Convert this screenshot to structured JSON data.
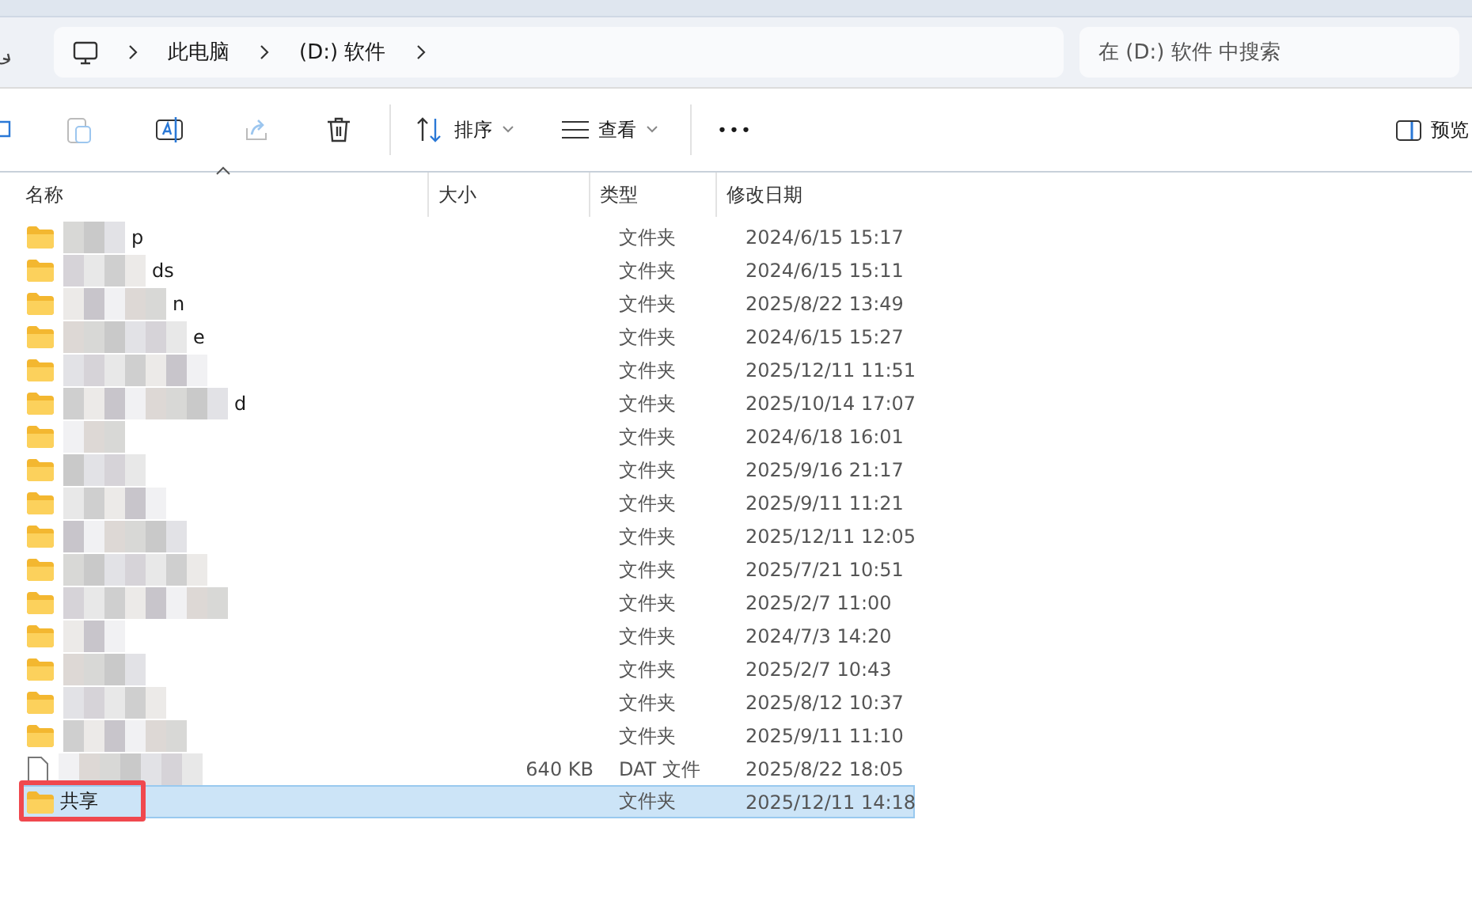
{
  "address_bar": {
    "segments": [
      "此电脑",
      "(D:) 软件"
    ]
  },
  "search": {
    "placeholder": "在 (D:) 软件 中搜索"
  },
  "toolbar": {
    "sort": "排序",
    "view": "查看",
    "more": "•••",
    "preview": "预览"
  },
  "columns": [
    "名称",
    "大小",
    "类型",
    "修改日期"
  ],
  "rows": [
    {
      "kind": "folder",
      "name_tail": "p",
      "redacted": true,
      "type": "文件夹",
      "modified": "2024/6/15 15:17",
      "selected": false
    },
    {
      "kind": "folder",
      "name_tail": "ds",
      "redacted": true,
      "type": "文件夹",
      "modified": "2024/6/15 15:11",
      "selected": false
    },
    {
      "kind": "folder",
      "name_tail": "n",
      "redacted": true,
      "type": "文件夹",
      "modified": "2025/8/22 13:49",
      "selected": false
    },
    {
      "kind": "folder",
      "name_tail": "e",
      "redacted": true,
      "type": "文件夹",
      "modified": "2024/6/15 15:27",
      "selected": false
    },
    {
      "kind": "folder",
      "redacted": true,
      "type": "文件夹",
      "modified": "2025/12/11 11:51",
      "selected": false
    },
    {
      "kind": "folder",
      "name_tail": "d",
      "redacted": true,
      "type": "文件夹",
      "modified": "2025/10/14 17:07",
      "selected": false
    },
    {
      "kind": "folder",
      "redacted": true,
      "type": "文件夹",
      "modified": "2024/6/18 16:01",
      "selected": false
    },
    {
      "kind": "folder",
      "redacted": true,
      "type": "文件夹",
      "modified": "2025/9/16 21:17",
      "selected": false
    },
    {
      "kind": "folder",
      "redacted": true,
      "type": "文件夹",
      "modified": "2025/9/11 11:21",
      "selected": false
    },
    {
      "kind": "folder",
      "redacted": true,
      "type": "文件夹",
      "modified": "2025/12/11 12:05",
      "selected": false
    },
    {
      "kind": "folder",
      "redacted": true,
      "type": "文件夹",
      "modified": "2025/7/21 10:51",
      "selected": false
    },
    {
      "kind": "folder",
      "redacted": true,
      "type": "文件夹",
      "modified": "2025/2/7 11:00",
      "selected": false
    },
    {
      "kind": "folder",
      "redacted": true,
      "type": "文件夹",
      "modified": "2024/7/3 14:20",
      "selected": false
    },
    {
      "kind": "folder",
      "redacted": true,
      "type": "文件夹",
      "modified": "2025/2/7 10:43",
      "selected": false
    },
    {
      "kind": "folder",
      "redacted": true,
      "type": "文件夹",
      "modified": "2025/8/12 10:37",
      "selected": false
    },
    {
      "kind": "folder",
      "redacted": true,
      "type": "文件夹",
      "modified": "2025/9/11 11:10",
      "selected": false
    },
    {
      "kind": "file",
      "redacted": true,
      "size": "640 KB",
      "type": "DAT 文件",
      "modified": "2025/8/22 18:05",
      "selected": false
    },
    {
      "kind": "folder",
      "name": "共享",
      "type": "文件夹",
      "modified": "2025/12/11 14:18",
      "selected": true,
      "annotated": true
    }
  ]
}
